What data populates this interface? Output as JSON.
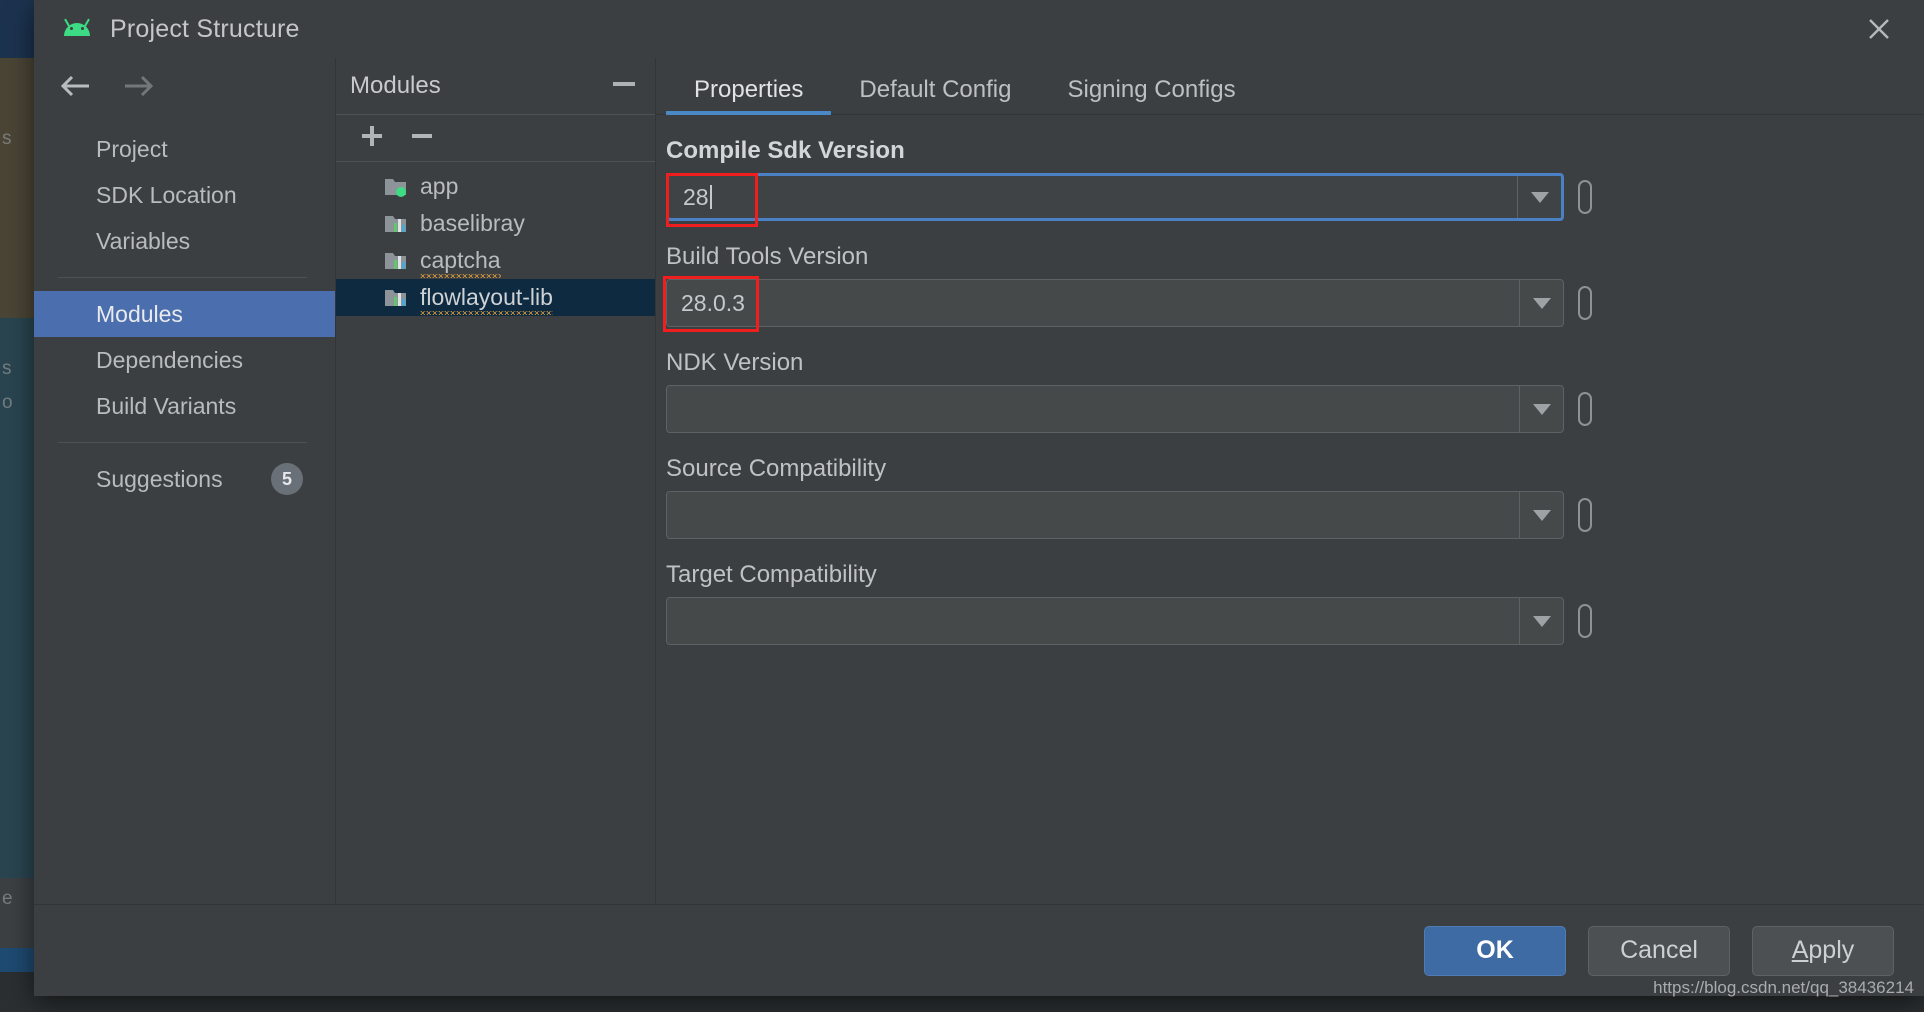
{
  "window": {
    "title": "Project Structure",
    "logo_icon": "android-logo-icon",
    "close_icon": "close-icon"
  },
  "nav": {
    "back_icon": "arrow-left-icon",
    "forward_icon": "arrow-right-icon",
    "items": [
      {
        "label": "Project",
        "selected": false
      },
      {
        "label": "SDK Location",
        "selected": false
      },
      {
        "label": "Variables",
        "selected": false
      },
      {
        "label": "Modules",
        "selected": true
      },
      {
        "label": "Dependencies",
        "selected": false
      },
      {
        "label": "Build Variants",
        "selected": false
      }
    ],
    "suggestions": {
      "label": "Suggestions",
      "count": "5"
    }
  },
  "modules_panel": {
    "title": "Modules",
    "minimize_icon": "minimize-icon",
    "add_icon": "plus-icon",
    "remove_icon": "minus-icon",
    "items": [
      {
        "label": "app",
        "icon": "module-folder-green-dot-icon",
        "selected": false,
        "spellcheck_error": false
      },
      {
        "label": "baselibray",
        "icon": "library-module-icon",
        "selected": false,
        "spellcheck_error": false
      },
      {
        "label": "captcha",
        "icon": "library-module-icon",
        "selected": false,
        "spellcheck_error": true
      },
      {
        "label": "flowlayout-lib",
        "icon": "library-module-icon",
        "selected": true,
        "spellcheck_error": true
      }
    ]
  },
  "tabs": [
    {
      "label": "Properties",
      "active": true
    },
    {
      "label": "Default Config",
      "active": false
    },
    {
      "label": "Signing Configs",
      "active": false
    }
  ],
  "form": {
    "fields": [
      {
        "label": "Compile Sdk Version",
        "value": "28",
        "placeholder": "",
        "focused": true,
        "bold_label": true,
        "annotated": true,
        "caret": true
      },
      {
        "label": "Build Tools Version",
        "value": "28.0.3",
        "placeholder": "",
        "focused": false,
        "bold_label": false,
        "annotated": true,
        "caret": false
      },
      {
        "label": "NDK Version",
        "value": "",
        "placeholder": "",
        "focused": false,
        "bold_label": false,
        "annotated": false,
        "caret": false
      },
      {
        "label": "Source Compatibility",
        "value": "",
        "placeholder": "",
        "focused": false,
        "bold_label": false,
        "annotated": false,
        "caret": false
      },
      {
        "label": "Target Compatibility",
        "value": "",
        "placeholder": "",
        "focused": false,
        "bold_label": false,
        "annotated": false,
        "caret": false
      }
    ],
    "dropdown_icon": "chevron-down-icon",
    "variable_button_icon": "pill-button-icon"
  },
  "footer": {
    "ok_label": "OK",
    "cancel_label": "Cancel",
    "apply_mnemonic": "A",
    "apply_rest": "pply"
  },
  "watermark": "https://blog.csdn.net/qq_38436214",
  "background": {
    "ghost_texts": [
      "s",
      "s",
      "o",
      "e"
    ]
  },
  "colors": {
    "dialog_bg": "#3c3f41",
    "nav_selected": "#4b6eaf",
    "module_selected": "#0d2a41",
    "tab_accent": "#4a88c7",
    "focus_ring": "#4a81c4",
    "annotation": "#f01e1e",
    "primary_button": "#3f6ba5",
    "android_green": "#3ddc84",
    "spellcheck": "#e8a33d"
  }
}
